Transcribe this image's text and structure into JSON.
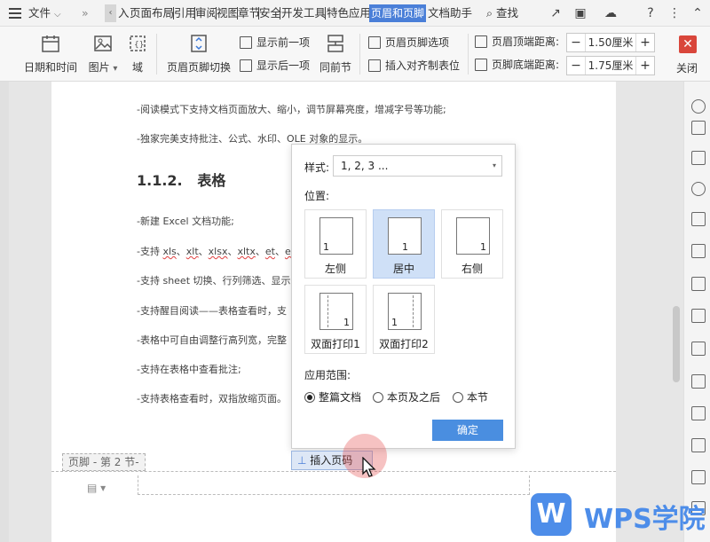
{
  "tabbar": {
    "file_label": "文件",
    "tabs": [
      "入",
      "页面布局",
      "引用",
      "审阅",
      "视图",
      "章节",
      "安全",
      "开发工具",
      "特色应用"
    ],
    "active_tab": "页眉和页脚",
    "after_tab": "文档助手",
    "search_label": "查找"
  },
  "ribbon": {
    "datetime_label": "日期和时间",
    "picture_label": "图片",
    "field_label": "域",
    "switch_label": "页眉页脚切换",
    "show_prev_label": "显示前一项",
    "show_next_label": "显示后一项",
    "same_prev_label": "同前节",
    "options_label": "页眉页脚选项",
    "insert_tab_label": "插入对齐制表位",
    "header_dist_label": "页眉顶端距离:",
    "header_dist_value": "1.50厘米",
    "footer_dist_label": "页脚底端距离:",
    "footer_dist_value": "1.75厘米",
    "close_label": "关闭"
  },
  "document": {
    "line1": "-阅读模式下支持文档页面放大、缩小，调节屏幕亮度，增减字号等功能;",
    "line2": "-独家完美支持批注、公式、水印、OLE 对象的显示。",
    "heading_num": "1.1.2.",
    "heading_text": "表格",
    "line3": "-新建 Excel 文档功能;",
    "line4_pre": "-支持 ",
    "line4_w1": "xls",
    "line4_w2": "xlt",
    "line4_w3": "xlsx",
    "line4_w4": "xltx",
    "line4_w5": "et",
    "line4_w6": "ett",
    "line5": "-支持 sheet 切换、行列筛选、显示",
    "line6": "-支持醒目阅读——表格查看时，支",
    "line7": "-表格中可自由调整行高列宽，完整",
    "line8": "-支持在表格中查看批注;",
    "line9": "-支持表格查看时，双指放缩页面。",
    "footer_label": "页脚  - 第 2 节-",
    "insert_page_label": "插入页码"
  },
  "dialog": {
    "style_label": "样式:",
    "style_value": "1, 2, 3 ...",
    "position_label": "位置:",
    "positions": [
      {
        "label": "左侧",
        "num": "1"
      },
      {
        "label": "居中",
        "num": "1"
      },
      {
        "label": "右侧",
        "num": "1"
      },
      {
        "label": "双面打印1",
        "num": "1"
      },
      {
        "label": "双面打印2",
        "num": "1"
      }
    ],
    "selected_position": "居中",
    "scope_label": "应用范围:",
    "scope_options": [
      "整篇文档",
      "本页及之后",
      "本节"
    ],
    "scope_selected": "整篇文档",
    "ok_label": "确定"
  },
  "watermark": {
    "logo_letter": "W",
    "text": "WPS学院"
  },
  "colors": {
    "accent": "#4a7fd8",
    "ok_button": "#4a8ee0",
    "close": "#d9463b",
    "selected_card": "#cfe0f7"
  }
}
